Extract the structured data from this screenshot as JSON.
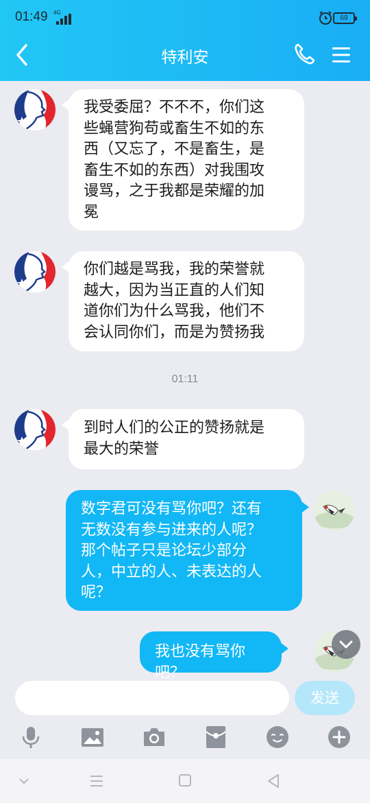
{
  "status": {
    "time": "01:49",
    "network": "4G",
    "battery": "69"
  },
  "header": {
    "title": "特利安"
  },
  "messages": [
    {
      "side": "in",
      "lines": [
        "我受委屈？不不不，你们这",
        "些蝇营狗苟或畜生不如的东",
        "西（又忘了，不是畜生，是",
        "畜生不如的东西）对我围攻",
        "谩骂，之于我都是荣耀的加",
        "冕"
      ]
    },
    {
      "side": "in",
      "lines": [
        "你们越是骂我，我的荣誉就",
        "越大，因为当正直的人们知",
        "道你们为什么骂我，他们不",
        "会认同你们，而是为赞扬我"
      ]
    },
    {
      "side": "in",
      "lines": [
        "到时人们的公正的赞扬就是",
        "最大的荣誉"
      ]
    },
    {
      "side": "out",
      "lines": [
        "数字君可没有骂你吧？还有",
        "无数没有参与进来的人呢？",
        "那个帖子只是论坛少部分",
        "人，中立的人、未表达的人",
        "呢？"
      ]
    },
    {
      "side": "out",
      "lines": [
        "我也没有骂你吧？"
      ]
    }
  ],
  "timestamp": "01:11",
  "input": {
    "placeholder": "",
    "value": "",
    "send_label": "发送"
  },
  "toolbar": [
    "microphone-icon",
    "image-icon",
    "camera-icon",
    "red-packet-icon",
    "emoji-icon",
    "plus-icon"
  ],
  "colors": {
    "header": "#1aaef5",
    "outgoing_bubble": "#12b7f5",
    "incoming_bubble": "#ffffff",
    "background": "#ebebf2",
    "send_button": "#b5e7fb"
  }
}
